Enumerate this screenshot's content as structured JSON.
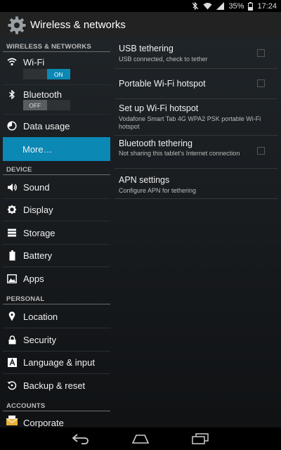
{
  "status": {
    "battery": "35%",
    "time": "17:24"
  },
  "app": {
    "title": "Wireless & networks"
  },
  "sidebar": {
    "headers": {
      "wireless": "WIRELESS & NETWORKS",
      "device": "DEVICE",
      "personal": "PERSONAL",
      "accounts": "ACCOUNTS"
    },
    "wifi": {
      "label": "Wi-Fi",
      "toggle": "ON"
    },
    "bluetooth": {
      "label": "Bluetooth",
      "toggle": "OFF"
    },
    "data_usage": "Data usage",
    "more": "More…",
    "sound": "Sound",
    "display": "Display",
    "storage": "Storage",
    "battery": "Battery",
    "apps": "Apps",
    "location": "Location",
    "security": "Security",
    "language": "Language & input",
    "backup": "Backup & reset",
    "corporate": "Corporate"
  },
  "main": {
    "usb": {
      "title": "USB tethering",
      "summary": "USB connected, check to tether"
    },
    "hotspot": {
      "title": "Portable Wi-Fi hotspot"
    },
    "setup": {
      "title": "Set up Wi-Fi hotspot",
      "summary": "Vodafone Smart Tab 4G WPA2 PSK portable Wi-Fi hotspot"
    },
    "bt": {
      "title": "Bluetooth tethering",
      "summary": "Not sharing this tablet's Internet connection"
    },
    "apn": {
      "title": "APN settings",
      "summary": "Configure APN for tethering"
    }
  }
}
